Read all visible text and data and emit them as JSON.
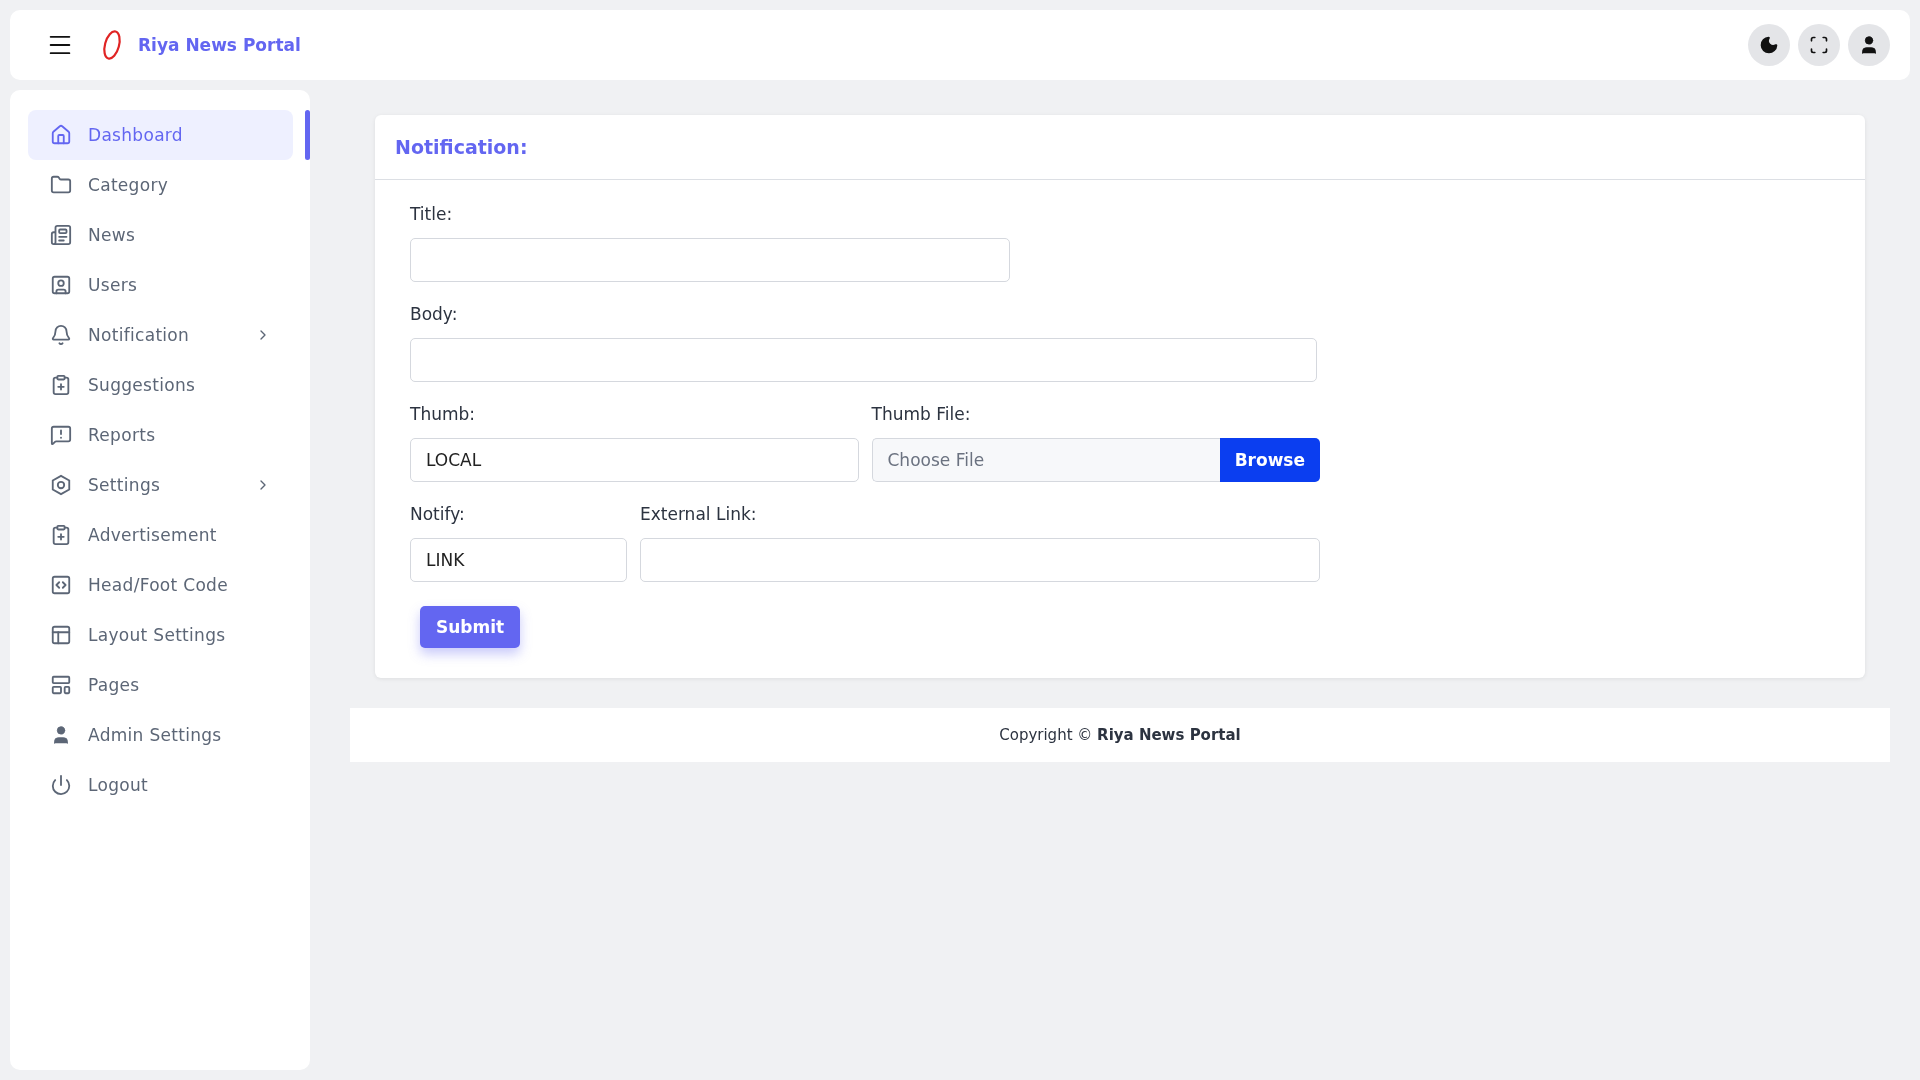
{
  "header": {
    "title": "Riya News Portal"
  },
  "sidebar": {
    "items": [
      {
        "label": "Dashboard",
        "selected": true,
        "has_submenu": false
      },
      {
        "label": "Category",
        "selected": false,
        "has_submenu": false
      },
      {
        "label": "News",
        "selected": false,
        "has_submenu": false
      },
      {
        "label": "Users",
        "selected": false,
        "has_submenu": false
      },
      {
        "label": "Notification",
        "selected": false,
        "has_submenu": true
      },
      {
        "label": "Suggestions",
        "selected": false,
        "has_submenu": false
      },
      {
        "label": "Reports",
        "selected": false,
        "has_submenu": false
      },
      {
        "label": "Settings",
        "selected": false,
        "has_submenu": true
      },
      {
        "label": "Advertisement",
        "selected": false,
        "has_submenu": false
      },
      {
        "label": "Head/Foot Code",
        "selected": false,
        "has_submenu": false
      },
      {
        "label": "Layout Settings",
        "selected": false,
        "has_submenu": false
      },
      {
        "label": "Pages",
        "selected": false,
        "has_submenu": false
      },
      {
        "label": "Admin Settings",
        "selected": false,
        "has_submenu": false
      },
      {
        "label": "Logout",
        "selected": false,
        "has_submenu": false
      }
    ]
  },
  "form": {
    "title": "Notification:",
    "rows": [
      [
        {
          "kind": "text",
          "label": "Title:"
        }
      ],
      [
        {
          "kind": "text",
          "label": "Body:"
        }
      ],
      [
        {
          "kind": "text",
          "label": "Thumb:",
          "value": "LOCAL"
        },
        {
          "kind": "file",
          "label": "Thumb File:",
          "placeholder": "Choose File",
          "button": "Browse"
        }
      ],
      [
        {
          "kind": "text",
          "label": "Notify:",
          "value": "LINK"
        },
        {
          "kind": "text",
          "label": "External Link:"
        }
      ]
    ],
    "submit": "Submit"
  },
  "footer": {
    "text": "Copyright © **Riya News Portal**"
  }
}
